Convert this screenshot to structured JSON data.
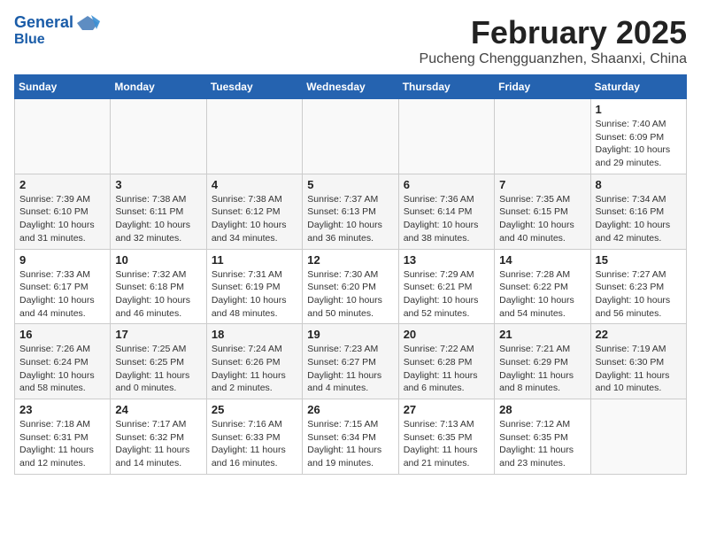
{
  "header": {
    "logo_line1": "General",
    "logo_line2": "Blue",
    "month_title": "February 2025",
    "location": "Pucheng Chengguanzhen, Shaanxi, China"
  },
  "weekdays": [
    "Sunday",
    "Monday",
    "Tuesday",
    "Wednesday",
    "Thursday",
    "Friday",
    "Saturday"
  ],
  "weeks": [
    [
      {
        "day": "",
        "info": ""
      },
      {
        "day": "",
        "info": ""
      },
      {
        "day": "",
        "info": ""
      },
      {
        "day": "",
        "info": ""
      },
      {
        "day": "",
        "info": ""
      },
      {
        "day": "",
        "info": ""
      },
      {
        "day": "1",
        "info": "Sunrise: 7:40 AM\nSunset: 6:09 PM\nDaylight: 10 hours\nand 29 minutes."
      }
    ],
    [
      {
        "day": "2",
        "info": "Sunrise: 7:39 AM\nSunset: 6:10 PM\nDaylight: 10 hours\nand 31 minutes."
      },
      {
        "day": "3",
        "info": "Sunrise: 7:38 AM\nSunset: 6:11 PM\nDaylight: 10 hours\nand 32 minutes."
      },
      {
        "day": "4",
        "info": "Sunrise: 7:38 AM\nSunset: 6:12 PM\nDaylight: 10 hours\nand 34 minutes."
      },
      {
        "day": "5",
        "info": "Sunrise: 7:37 AM\nSunset: 6:13 PM\nDaylight: 10 hours\nand 36 minutes."
      },
      {
        "day": "6",
        "info": "Sunrise: 7:36 AM\nSunset: 6:14 PM\nDaylight: 10 hours\nand 38 minutes."
      },
      {
        "day": "7",
        "info": "Sunrise: 7:35 AM\nSunset: 6:15 PM\nDaylight: 10 hours\nand 40 minutes."
      },
      {
        "day": "8",
        "info": "Sunrise: 7:34 AM\nSunset: 6:16 PM\nDaylight: 10 hours\nand 42 minutes."
      }
    ],
    [
      {
        "day": "9",
        "info": "Sunrise: 7:33 AM\nSunset: 6:17 PM\nDaylight: 10 hours\nand 44 minutes."
      },
      {
        "day": "10",
        "info": "Sunrise: 7:32 AM\nSunset: 6:18 PM\nDaylight: 10 hours\nand 46 minutes."
      },
      {
        "day": "11",
        "info": "Sunrise: 7:31 AM\nSunset: 6:19 PM\nDaylight: 10 hours\nand 48 minutes."
      },
      {
        "day": "12",
        "info": "Sunrise: 7:30 AM\nSunset: 6:20 PM\nDaylight: 10 hours\nand 50 minutes."
      },
      {
        "day": "13",
        "info": "Sunrise: 7:29 AM\nSunset: 6:21 PM\nDaylight: 10 hours\nand 52 minutes."
      },
      {
        "day": "14",
        "info": "Sunrise: 7:28 AM\nSunset: 6:22 PM\nDaylight: 10 hours\nand 54 minutes."
      },
      {
        "day": "15",
        "info": "Sunrise: 7:27 AM\nSunset: 6:23 PM\nDaylight: 10 hours\nand 56 minutes."
      }
    ],
    [
      {
        "day": "16",
        "info": "Sunrise: 7:26 AM\nSunset: 6:24 PM\nDaylight: 10 hours\nand 58 minutes."
      },
      {
        "day": "17",
        "info": "Sunrise: 7:25 AM\nSunset: 6:25 PM\nDaylight: 11 hours\nand 0 minutes."
      },
      {
        "day": "18",
        "info": "Sunrise: 7:24 AM\nSunset: 6:26 PM\nDaylight: 11 hours\nand 2 minutes."
      },
      {
        "day": "19",
        "info": "Sunrise: 7:23 AM\nSunset: 6:27 PM\nDaylight: 11 hours\nand 4 minutes."
      },
      {
        "day": "20",
        "info": "Sunrise: 7:22 AM\nSunset: 6:28 PM\nDaylight: 11 hours\nand 6 minutes."
      },
      {
        "day": "21",
        "info": "Sunrise: 7:21 AM\nSunset: 6:29 PM\nDaylight: 11 hours\nand 8 minutes."
      },
      {
        "day": "22",
        "info": "Sunrise: 7:19 AM\nSunset: 6:30 PM\nDaylight: 11 hours\nand 10 minutes."
      }
    ],
    [
      {
        "day": "23",
        "info": "Sunrise: 7:18 AM\nSunset: 6:31 PM\nDaylight: 11 hours\nand 12 minutes."
      },
      {
        "day": "24",
        "info": "Sunrise: 7:17 AM\nSunset: 6:32 PM\nDaylight: 11 hours\nand 14 minutes."
      },
      {
        "day": "25",
        "info": "Sunrise: 7:16 AM\nSunset: 6:33 PM\nDaylight: 11 hours\nand 16 minutes."
      },
      {
        "day": "26",
        "info": "Sunrise: 7:15 AM\nSunset: 6:34 PM\nDaylight: 11 hours\nand 19 minutes."
      },
      {
        "day": "27",
        "info": "Sunrise: 7:13 AM\nSunset: 6:35 PM\nDaylight: 11 hours\nand 21 minutes."
      },
      {
        "day": "28",
        "info": "Sunrise: 7:12 AM\nSunset: 6:35 PM\nDaylight: 11 hours\nand 23 minutes."
      },
      {
        "day": "",
        "info": ""
      }
    ]
  ]
}
